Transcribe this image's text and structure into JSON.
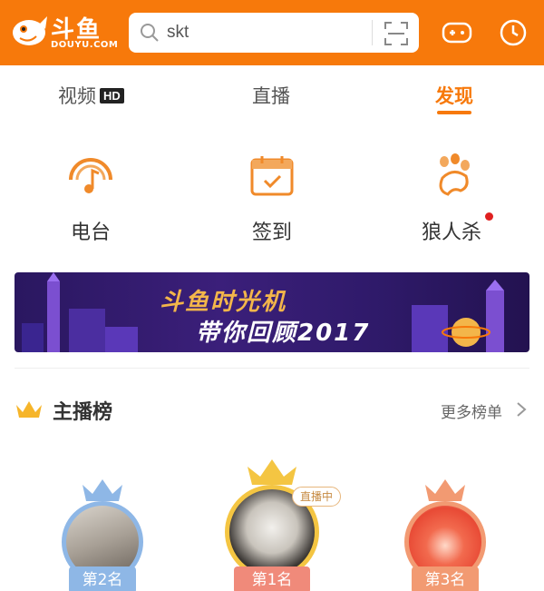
{
  "header": {
    "logo_cn": "斗鱼",
    "logo_en": "DOUYU.COM",
    "search_value": "skt"
  },
  "tabs": {
    "video": "视频",
    "video_badge": "HD",
    "live": "直播",
    "discover": "发现",
    "active": "discover"
  },
  "entries": [
    {
      "label": "电台",
      "icon": "radio-icon"
    },
    {
      "label": "签到",
      "icon": "calendar-icon"
    },
    {
      "label": "狼人杀",
      "icon": "paw-icon"
    }
  ],
  "banner": {
    "line1": "斗鱼时光机",
    "line2": "带你回顾2017"
  },
  "ranking": {
    "title": "主播榜",
    "more": "更多榜单",
    "podium": [
      {
        "rank_label": "第2名",
        "color": "#8eb7e6"
      },
      {
        "rank_label": "第1名",
        "color": "#f4c542",
        "live_tag": "直播中"
      },
      {
        "rank_label": "第3名",
        "color": "#f29a72"
      }
    ]
  },
  "colors": {
    "accent": "#f7790b",
    "badge_dot": "#e02020"
  }
}
